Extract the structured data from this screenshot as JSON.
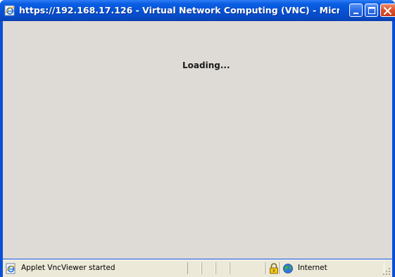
{
  "window": {
    "title": "https://192.168.17.126 - Virtual Network Computing (VNC) - Micr...",
    "app_icon": "ie-page-icon",
    "controls": {
      "minimize_icon": "minimize-icon",
      "maximize_icon": "maximize-icon",
      "close_icon": "close-icon"
    }
  },
  "content": {
    "loading_text": "Loading..."
  },
  "statusbar": {
    "status_text": "Applet VncViewer started",
    "status_icon": "ie-page-icon",
    "secure_icon": "padlock-icon",
    "zone_icon": "globe-icon",
    "zone_text": "Internet"
  },
  "colors": {
    "titlebar": "#0651d4",
    "client_background": "#dedbd6",
    "statusbar_background": "#ece9d8",
    "close_button": "#e0502a"
  }
}
